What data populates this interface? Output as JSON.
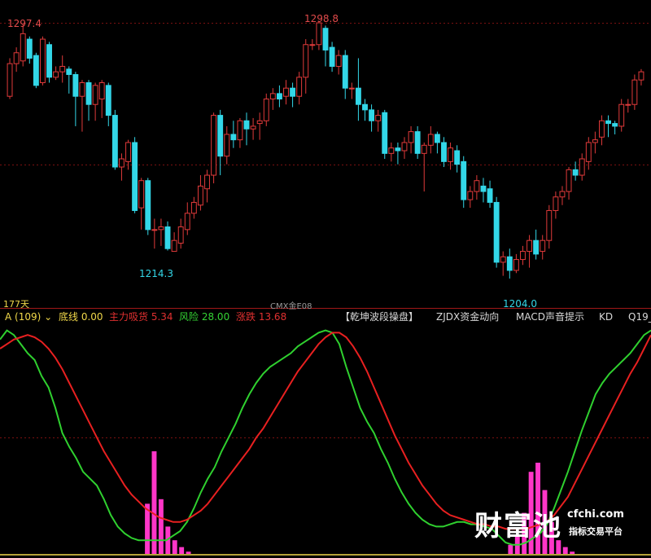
{
  "header": {
    "days_label": "177天",
    "symbol_label": "CMX金E08"
  },
  "price_labels": {
    "high_left": "1297.4",
    "high_mid": "1298.8",
    "low_left": "1214.3",
    "low_right": "1204.0"
  },
  "indicator_bar": {
    "name": "A (109)",
    "dropdown_icon": "chevron-down-icon",
    "items": [
      {
        "label": "底线",
        "value": "0.00",
        "color": "#f0d84a"
      },
      {
        "label": "主力吸货",
        "value": "5.34",
        "color": "#e03030"
      },
      {
        "label": "风险",
        "value": "28.00",
        "color": "#34d334"
      },
      {
        "label": "涨跌",
        "value": "13.68",
        "color": "#e03030"
      }
    ],
    "tabs": [
      "【乾坤波段操盘】",
      "ZJDX资金动向",
      "MACD声音提示",
      "KD",
      "Q19_"
    ]
  },
  "watermark": {
    "brand": "财富池",
    "site": "cfchi.com",
    "subtitle": "指标交易平台"
  },
  "colors": {
    "up": "#e03a3a",
    "down": "#33d7e8",
    "slow_line": "#e82020",
    "fast_line": "#2fd02f",
    "histogram": "#ff36c8",
    "grid": "#7a1010"
  },
  "chart_data": [
    {
      "type": "candlestick",
      "title": "",
      "y_axis": {
        "min": 1195,
        "max": 1304
      },
      "annotations": [
        {
          "text": "1297.4",
          "kind": "high",
          "index": 1
        },
        {
          "text": "1298.8",
          "kind": "high",
          "index": 47
        },
        {
          "text": "1214.3",
          "kind": "low",
          "index": 22
        },
        {
          "text": "1204.0",
          "kind": "low",
          "index": 76
        }
      ],
      "candles": [
        [
          1271,
          1283,
          1270,
          1285
        ],
        [
          1283,
          1287,
          1280,
          1289
        ],
        [
          1284,
          1294,
          1282,
          1297.4
        ],
        [
          1292,
          1285,
          1283,
          1293
        ],
        [
          1286,
          1275,
          1274,
          1287
        ],
        [
          1276,
          1292,
          1275,
          1293
        ],
        [
          1290,
          1278,
          1276,
          1291
        ],
        [
          1278,
          1280,
          1277,
          1282
        ],
        [
          1280,
          1282,
          1276,
          1286
        ],
        [
          1281,
          1279,
          1272,
          1282
        ],
        [
          1279,
          1271,
          1260,
          1280
        ],
        [
          1271,
          1276,
          1258,
          1277
        ],
        [
          1276,
          1268,
          1262,
          1277
        ],
        [
          1268,
          1275,
          1262,
          1276
        ],
        [
          1270,
          1276,
          1263,
          1277
        ],
        [
          1275,
          1264,
          1260,
          1276
        ],
        [
          1264,
          1245,
          1244,
          1266
        ],
        [
          1245,
          1248,
          1240,
          1250
        ],
        [
          1247,
          1254,
          1244,
          1255
        ],
        [
          1254,
          1229,
          1228,
          1256
        ],
        [
          1230,
          1240,
          1222,
          1241
        ],
        [
          1240,
          1222,
          1220,
          1241
        ],
        [
          1222,
          1222,
          1215,
          1226
        ],
        [
          1222,
          1223,
          1216,
          1226
        ],
        [
          1223,
          1215,
          1214.3,
          1225
        ],
        [
          1214,
          1218,
          1214,
          1221
        ],
        [
          1217,
          1223,
          1215,
          1226
        ],
        [
          1222,
          1228,
          1220,
          1232
        ],
        [
          1228,
          1232,
          1226,
          1234
        ],
        [
          1231,
          1238,
          1229,
          1242
        ],
        [
          1237,
          1242,
          1232,
          1244
        ],
        [
          1242,
          1264,
          1239,
          1265
        ],
        [
          1264,
          1249,
          1242,
          1266
        ],
        [
          1249,
          1257,
          1246,
          1260
        ],
        [
          1257,
          1255,
          1252,
          1262
        ],
        [
          1255,
          1262,
          1252,
          1263
        ],
        [
          1262,
          1259,
          1253,
          1265
        ],
        [
          1259,
          1260,
          1255,
          1263
        ],
        [
          1261,
          1262,
          1255,
          1265
        ],
        [
          1262,
          1270,
          1260,
          1272
        ],
        [
          1270,
          1272,
          1266,
          1274
        ],
        [
          1272,
          1270,
          1267,
          1275
        ],
        [
          1271,
          1274,
          1268,
          1277
        ],
        [
          1274,
          1271,
          1267,
          1276
        ],
        [
          1271,
          1278,
          1268,
          1280
        ],
        [
          1278,
          1290,
          1272,
          1292
        ],
        [
          1290,
          1290,
          1288,
          1292
        ],
        [
          1290,
          1298,
          1288,
          1298.8
        ],
        [
          1296,
          1288,
          1282,
          1297
        ],
        [
          1289,
          1282,
          1280,
          1291
        ],
        [
          1282,
          1286,
          1279,
          1288
        ],
        [
          1286,
          1274,
          1270,
          1288
        ],
        [
          1274,
          1274,
          1270,
          1276
        ],
        [
          1274,
          1268,
          1262,
          1285
        ],
        [
          1268,
          1266,
          1262,
          1270
        ],
        [
          1266,
          1262,
          1258,
          1268
        ],
        [
          1262,
          1264,
          1258,
          1266
        ],
        [
          1265,
          1250,
          1248,
          1266
        ],
        [
          1250,
          1252,
          1247,
          1254
        ],
        [
          1252,
          1251,
          1246,
          1254
        ],
        [
          1251,
          1254,
          1248,
          1256
        ],
        [
          1254,
          1258,
          1250,
          1260
        ],
        [
          1258,
          1250,
          1248,
          1260
        ],
        [
          1250,
          1253,
          1236,
          1254
        ],
        [
          1253,
          1257,
          1250,
          1260
        ],
        [
          1257,
          1254,
          1250,
          1258
        ],
        [
          1254,
          1247,
          1245,
          1256
        ],
        [
          1247,
          1252,
          1244,
          1254
        ],
        [
          1251,
          1246,
          1243,
          1253
        ],
        [
          1247,
          1233,
          1230,
          1249
        ],
        [
          1233,
          1236,
          1230,
          1238
        ],
        [
          1236,
          1240,
          1233,
          1242
        ],
        [
          1238,
          1236,
          1232,
          1241
        ],
        [
          1237,
          1232,
          1230,
          1240
        ],
        [
          1232,
          1210,
          1208,
          1234
        ],
        [
          1210,
          1212,
          1205,
          1214
        ],
        [
          1212,
          1207,
          1204,
          1215
        ],
        [
          1207,
          1211,
          1206,
          1213
        ],
        [
          1211,
          1214,
          1209,
          1216
        ],
        [
          1214,
          1218,
          1208,
          1220
        ],
        [
          1218,
          1213,
          1211,
          1222
        ],
        [
          1214,
          1218,
          1211,
          1220
        ],
        [
          1218,
          1229,
          1215,
          1231
        ],
        [
          1229,
          1234,
          1226,
          1236
        ],
        [
          1234,
          1236,
          1231,
          1238
        ],
        [
          1236,
          1244,
          1233,
          1245
        ],
        [
          1244,
          1242,
          1240,
          1247
        ],
        [
          1242,
          1248,
          1240,
          1250
        ],
        [
          1247,
          1254,
          1244,
          1256
        ],
        [
          1254,
          1255,
          1250,
          1258
        ],
        [
          1256,
          1262,
          1253,
          1264
        ],
        [
          1262,
          1261,
          1256,
          1264
        ],
        [
          1261,
          1260,
          1257,
          1262
        ],
        [
          1260,
          1268,
          1258,
          1270
        ],
        [
          1268,
          1268,
          1265,
          1270
        ],
        [
          1268,
          1277,
          1266,
          1279
        ],
        [
          1277,
          1280,
          1275,
          1281
        ]
      ]
    },
    {
      "type": "line",
      "title": "",
      "y_axis": {
        "min": 0,
        "max": 100
      },
      "series": [
        {
          "key": "fast",
          "color": "#2fd02f",
          "values": [
            94,
            98,
            96,
            92,
            88,
            85,
            78,
            73,
            64,
            53,
            47,
            42,
            36,
            33,
            30,
            24,
            17,
            12,
            9,
            7,
            6,
            6,
            6,
            6,
            6,
            8,
            10,
            14,
            20,
            27,
            33,
            38,
            45,
            51,
            57,
            64,
            70,
            75,
            79,
            82,
            84,
            86,
            88,
            91,
            93,
            95,
            97,
            98,
            97,
            92,
            82,
            73,
            64,
            58,
            53,
            46,
            40,
            33,
            27,
            22,
            18,
            15,
            13,
            12,
            12,
            13,
            14,
            14,
            13,
            13,
            12,
            11,
            8,
            5,
            4,
            4,
            5,
            7,
            9,
            13,
            20,
            28,
            36,
            45,
            54,
            62,
            70,
            75,
            79,
            82,
            85,
            88,
            92,
            96,
            98
          ]
        },
        {
          "key": "slow",
          "color": "#e82020",
          "values": [
            90,
            92,
            94,
            95,
            96,
            95,
            93,
            90,
            86,
            81,
            75,
            69,
            63,
            57,
            51,
            45,
            40,
            35,
            30,
            26,
            23,
            20,
            18,
            16,
            15,
            14,
            14,
            15,
            17,
            19,
            22,
            26,
            30,
            34,
            38,
            42,
            46,
            51,
            55,
            60,
            65,
            70,
            75,
            80,
            84,
            88,
            92,
            95,
            97,
            97,
            95,
            91,
            86,
            80,
            73,
            66,
            59,
            52,
            46,
            40,
            35,
            30,
            26,
            22,
            19,
            17,
            16,
            15,
            14,
            13,
            13,
            12,
            12,
            11,
            11,
            11,
            11,
            12,
            13,
            14,
            17,
            21,
            25,
            31,
            37,
            43,
            49,
            55,
            61,
            67,
            73,
            79,
            84,
            90,
            96
          ]
        }
      ]
    },
    {
      "type": "bar",
      "title": "",
      "y_axis": {
        "min": 0,
        "max": 100
      },
      "series": [
        {
          "key": "histogram",
          "color": "#ff36c8",
          "values": [
            0,
            0,
            0,
            0,
            0,
            0,
            0,
            0,
            0,
            0,
            0,
            0,
            0,
            0,
            0,
            0,
            0,
            0,
            0,
            0,
            0,
            22,
            45,
            24,
            12,
            6,
            3,
            1,
            0,
            0,
            0,
            0,
            0,
            0,
            0,
            0,
            0,
            0,
            0,
            0,
            0,
            0,
            0,
            0,
            0,
            0,
            0,
            0,
            0,
            0,
            0,
            0,
            0,
            0,
            0,
            0,
            0,
            0,
            0,
            0,
            0,
            0,
            0,
            0,
            0,
            0,
            0,
            0,
            0,
            0,
            0,
            0,
            0,
            0,
            4,
            8,
            18,
            36,
            40,
            28,
            14,
            6,
            3,
            1,
            0,
            0,
            0,
            0,
            0,
            0,
            0,
            0,
            0,
            0,
            0
          ]
        }
      ]
    }
  ]
}
